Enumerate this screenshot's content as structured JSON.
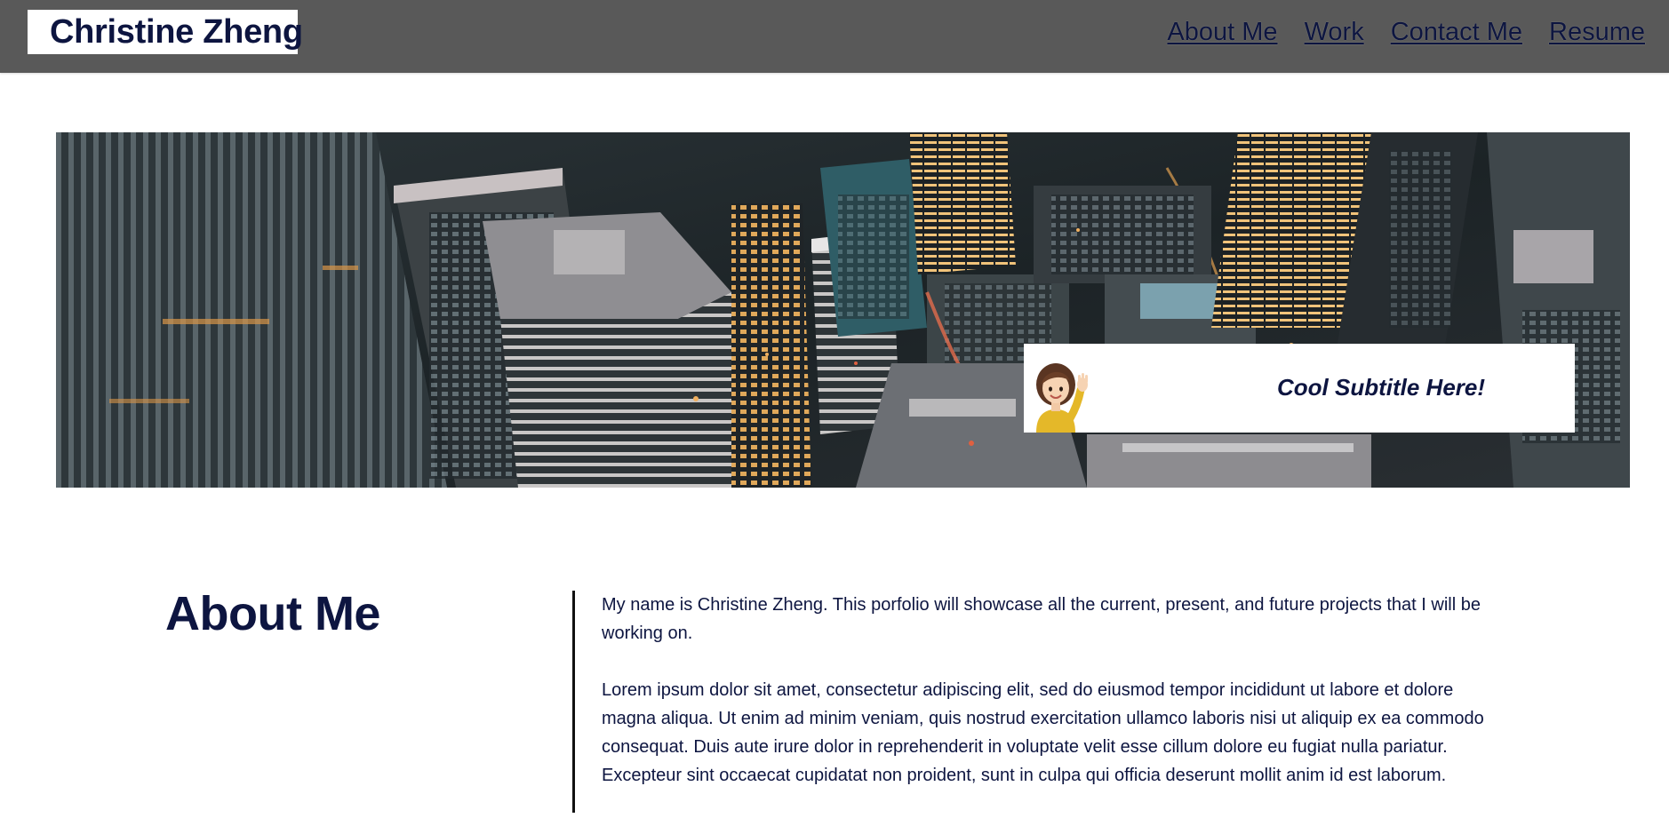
{
  "header": {
    "brand": "Christine Zheng",
    "nav": [
      "About Me",
      "Work",
      "Contact Me",
      "Resume"
    ]
  },
  "hero": {
    "subtitle": "Cool Subtitle Here!",
    "image": "aerial-city-skyline-photo",
    "avatar": "waving-woman-memoji"
  },
  "about": {
    "title": "About Me",
    "paragraphs": [
      "My name is Christine Zheng. This porfolio will showcase all the current, present, and future projects that I will be working on.",
      "Lorem ipsum dolor sit amet, consectetur adipiscing elit, sed do eiusmod tempor incididunt ut labore et dolore magna aliqua. Ut enim ad minim veniam, quis nostrud exercitation ullamco laboris nisi ut aliquip ex ea commodo consequat. Duis aute irure dolor in reprehenderit in voluptate velit esse cillum dolore eu fugiat nulla pariatur. Excepteur sint occaecat cupidatat non proident, sunt in culpa qui officia deserunt mollit anim id est laborum."
    ]
  },
  "colors": {
    "header_bg": "#595959",
    "text": "#0d1540",
    "page_bg": "#ffffff"
  }
}
